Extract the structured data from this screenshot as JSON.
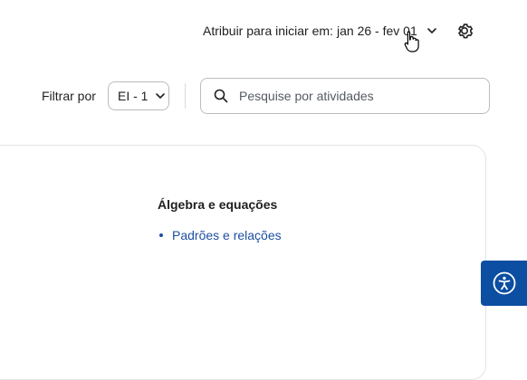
{
  "header": {
    "assign_label": "Atribuir para iniciar em:",
    "date_range": "jan 26 - fev 01"
  },
  "filters": {
    "label": "Filtrar por",
    "selected": "EI - 1"
  },
  "search": {
    "placeholder": "Pesquise por atividades"
  },
  "content": {
    "section_title": "Álgebra e equações",
    "topics": [
      {
        "label": "Padrões e relações"
      }
    ]
  },
  "icons": {
    "gear": "gear-icon",
    "search": "search-icon",
    "chevron": "chevron-down-icon",
    "accessibility": "accessibility-icon"
  },
  "colors": {
    "link": "#1e4fa0",
    "accessibility_button": "#0b4ea2",
    "border": "#b9bcc2"
  }
}
